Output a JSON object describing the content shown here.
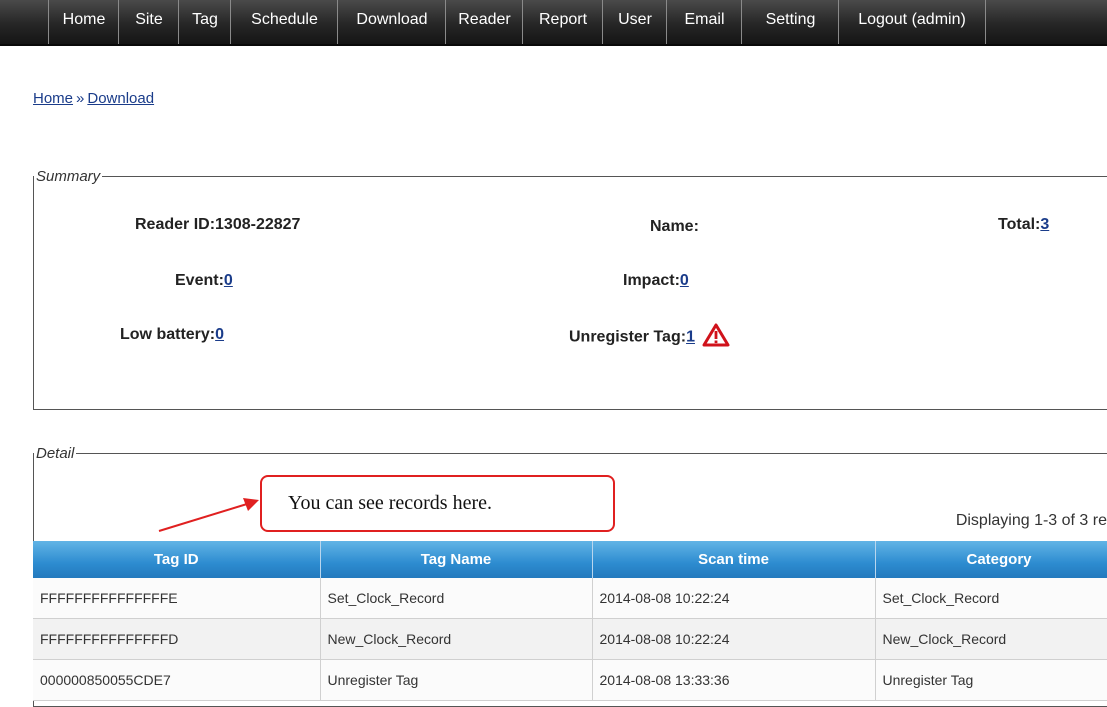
{
  "nav": {
    "items": [
      {
        "label": "Home"
      },
      {
        "label": "Site"
      },
      {
        "label": "Tag"
      },
      {
        "label": "Schedule"
      },
      {
        "label": "Download"
      },
      {
        "label": "Reader"
      },
      {
        "label": "Report"
      },
      {
        "label": "User"
      },
      {
        "label": "Email"
      },
      {
        "label": "Setting"
      },
      {
        "label": "Logout (admin)"
      }
    ]
  },
  "breadcrumb": {
    "home": "Home",
    "separator": "»",
    "current": "Download"
  },
  "summary": {
    "legend": "Summary",
    "reader_id_label": "Reader ID:",
    "reader_id_value": "1308-22827",
    "name_label": "Name:",
    "total_label": "Total:",
    "total_value": "3",
    "event_label": "Event:",
    "event_value": "0",
    "impact_label": "Impact:",
    "impact_value": "0",
    "low_battery_label": "Low battery:",
    "low_battery_value": "0",
    "unregister_label": "Unregister Tag:",
    "unregister_value": "1",
    "warning_icon": "warning-triangle-icon"
  },
  "detail": {
    "legend": "Detail",
    "callout": "You can see records here.",
    "displaying": "Displaying 1-3 of 3 re",
    "columns": [
      "Tag ID",
      "Tag Name",
      "Scan time",
      "Category"
    ],
    "rows": [
      [
        "FFFFFFFFFFFFFFFE",
        "Set_Clock_Record",
        "2014-08-08 10:22:24",
        "Set_Clock_Record"
      ],
      [
        "FFFFFFFFFFFFFFFD",
        "New_Clock_Record",
        "2014-08-08 10:22:24",
        "New_Clock_Record"
      ],
      [
        "000000850055CDE7",
        "Unregister Tag",
        "2014-08-08 13:33:36",
        "Unregister Tag"
      ]
    ]
  },
  "colors": {
    "nav_bg": "#262626",
    "header_blue": "#2d8cd0",
    "callout_red": "#e02020",
    "link": "#1a3c8a"
  }
}
